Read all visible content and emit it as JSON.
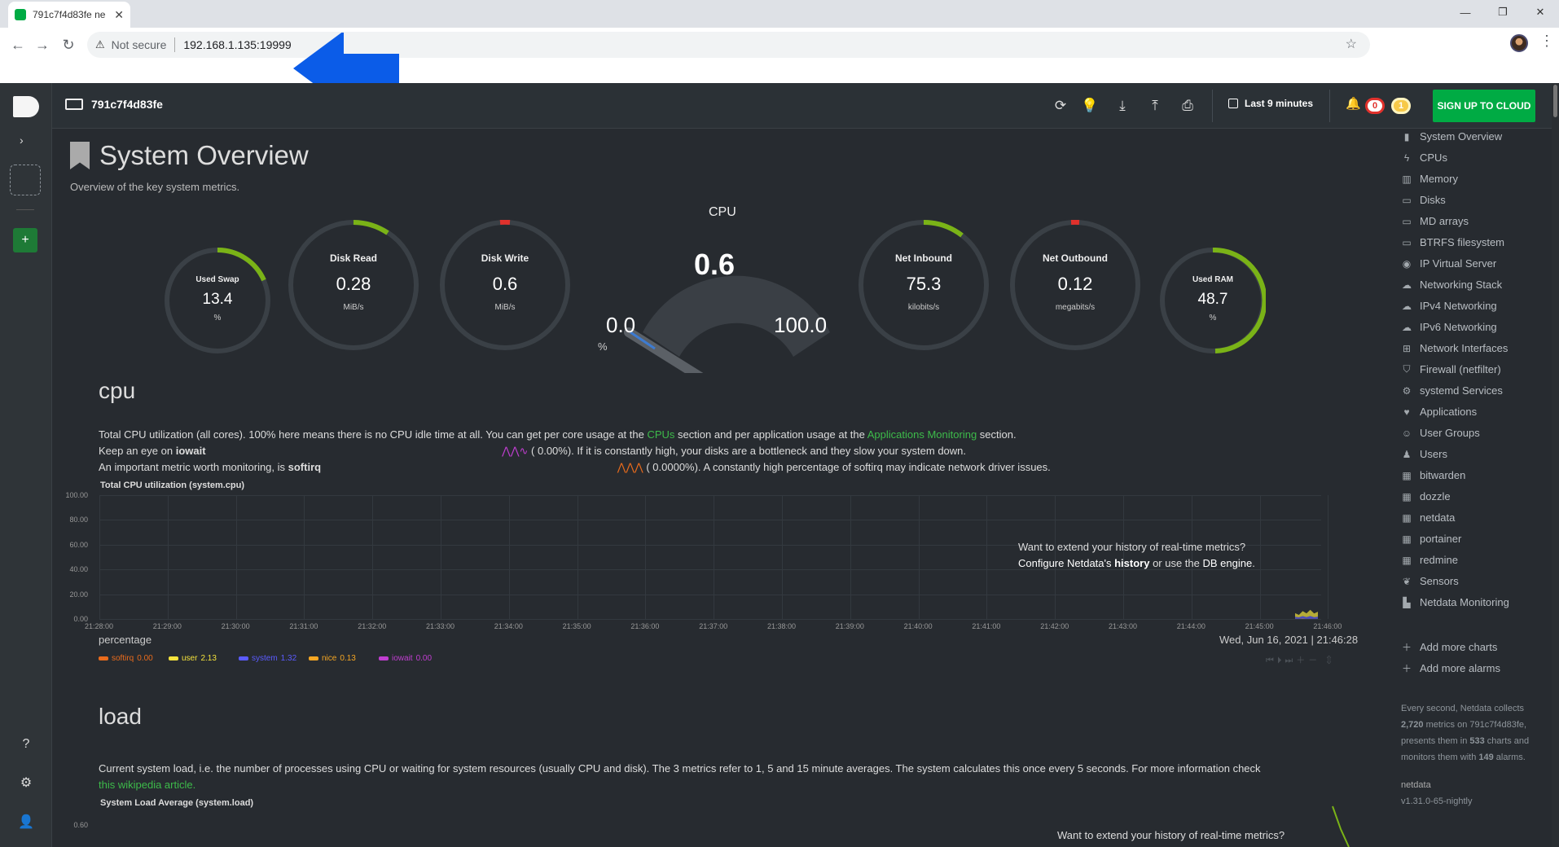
{
  "browser": {
    "tab_title": "791c7f4d83fe ne",
    "security_label": "Not secure",
    "url": "192.168.1.135:19999",
    "window_controls": [
      "minimize",
      "restore",
      "close"
    ]
  },
  "topbar": {
    "hostname": "791c7f4d83fe",
    "time_range": "Last 9 minutes",
    "alarms_critical": "0",
    "alarms_warning": "1",
    "signup_label": "SIGN UP TO CLOUD"
  },
  "overview": {
    "title": "System Overview",
    "subtitle": "Overview of the key system metrics."
  },
  "gauges": [
    {
      "label": "Used Swap",
      "value": "13.4",
      "unit": "%"
    },
    {
      "label": "Disk Read",
      "value": "0.28",
      "unit": "MiB/s"
    },
    {
      "label": "Disk Write",
      "value": "0.6",
      "unit": "MiB/s"
    },
    {
      "label": "Net Inbound",
      "value": "75.3",
      "unit": "kilobits/s"
    },
    {
      "label": "Net Outbound",
      "value": "0.12",
      "unit": "megabits/s"
    },
    {
      "label": "Used RAM",
      "value": "48.7",
      "unit": "%"
    }
  ],
  "cpu_gauge": {
    "label": "CPU",
    "value": "0.6",
    "min": "0.0",
    "max": "100.0",
    "unit": "%"
  },
  "cpu_section": {
    "title": "cpu",
    "desc1_a": "Total CPU utilization (all cores). 100% here means there is no CPU idle time at all. You can get per core usage at the ",
    "desc1_link1": "CPUs",
    "desc1_b": " section and per application usage at the ",
    "desc1_link2": "Applications Monitoring",
    "desc1_c": " section.",
    "desc2_a": "Keep an eye on ",
    "desc2_bold": "iowait",
    "desc2_pct": "(      0.00%). If it is constantly high, your disks are a bottleneck and they slow your system down.",
    "desc3_a": "An important metric worth monitoring, is ",
    "desc3_bold": "softirq",
    "desc3_pct": "(  0.0000%). A constantly high percentage of softirq may indicate network driver issues.",
    "chart_title": "Total CPU utilization (system.cpu)",
    "history_1": "Want to extend your history of real-time metrics?",
    "history_2a": "Configure Netdata's ",
    "history_2b": "history",
    "history_2c": " or use the ",
    "history_2d": "DB engine",
    "history_2e": ".",
    "units": "percentage",
    "timestamp": "Wed, Jun 16, 2021 | 21:46:28"
  },
  "chart_data": {
    "type": "area",
    "title": "Total CPU utilization (system.cpu)",
    "ylabel": "percentage",
    "ylim": [
      0,
      100
    ],
    "yticks": [
      "100.00",
      "80.00",
      "60.00",
      "40.00",
      "20.00",
      "0.00"
    ],
    "x": [
      "21:28:00",
      "21:29:00",
      "21:30:00",
      "21:31:00",
      "21:32:00",
      "21:33:00",
      "21:34:00",
      "21:35:00",
      "21:36:00",
      "21:37:00",
      "21:38:00",
      "21:39:00",
      "21:40:00",
      "21:41:00",
      "21:42:00",
      "21:43:00",
      "21:44:00",
      "21:45:00",
      "21:46:00"
    ],
    "series": [
      {
        "name": "softirq",
        "value": "0.00",
        "color": "#e96b1c"
      },
      {
        "name": "user",
        "value": "2.13",
        "color": "#f4e23c"
      },
      {
        "name": "system",
        "value": "1.32",
        "color": "#5b5bff"
      },
      {
        "name": "nice",
        "value": "0.13",
        "color": "#f5a623"
      },
      {
        "name": "iowait",
        "value": "0.00",
        "color": "#c03ed0"
      }
    ]
  },
  "load_section": {
    "title": "load",
    "desc_a": "Current system load, i.e. the number of processes using CPU or waiting for system resources (usually CPU and disk). The 3 metrics refer to 1, 5 and 15 minute averages. The system calculates this once every 5 seconds. For more information check",
    "desc_link": "this wikipedia article",
    "desc_end": ".",
    "chart_title": "System Load Average (system.load)",
    "ytick": "0.60",
    "history_1": "Want to extend your history of real-time metrics?"
  },
  "rightnav": {
    "items": [
      {
        "label": "System Overview",
        "icon": "bookmark-icon"
      },
      {
        "label": "CPUs",
        "icon": "bolt-icon"
      },
      {
        "label": "Memory",
        "icon": "memory-icon"
      },
      {
        "label": "Disks",
        "icon": "hdd-icon"
      },
      {
        "label": "MD arrays",
        "icon": "hdd-icon"
      },
      {
        "label": "BTRFS filesystem",
        "icon": "hdd-icon"
      },
      {
        "label": "IP Virtual Server",
        "icon": "eye-icon"
      },
      {
        "label": "Networking Stack",
        "icon": "cloud-icon"
      },
      {
        "label": "IPv4 Networking",
        "icon": "cloud-icon"
      },
      {
        "label": "IPv6 Networking",
        "icon": "cloud-icon"
      },
      {
        "label": "Network Interfaces",
        "icon": "sitemap-icon"
      },
      {
        "label": "Firewall (netfilter)",
        "icon": "shield-icon"
      },
      {
        "label": "systemd Services",
        "icon": "cogs-icon"
      },
      {
        "label": "Applications",
        "icon": "heart-icon"
      },
      {
        "label": "User Groups",
        "icon": "users-icon"
      },
      {
        "label": "Users",
        "icon": "user-icon"
      },
      {
        "label": "bitwarden",
        "icon": "grid-icon"
      },
      {
        "label": "dozzle",
        "icon": "grid-icon"
      },
      {
        "label": "netdata",
        "icon": "grid-icon"
      },
      {
        "label": "portainer",
        "icon": "grid-icon"
      },
      {
        "label": "redmine",
        "icon": "grid-icon"
      },
      {
        "label": "Sensors",
        "icon": "leaf-icon"
      },
      {
        "label": "Netdata Monitoring",
        "icon": "chart-icon"
      }
    ],
    "add_charts": "Add more charts",
    "add_alarms": "Add more alarms",
    "footer_a": "Every second, Netdata collects ",
    "footer_metrics": "2,720",
    "footer_b": " metrics on 791c7f4d83fe, presents them in ",
    "footer_charts": "533",
    "footer_c": " charts and monitors them with ",
    "footer_alarms": "149",
    "footer_d": " alarms.",
    "version_name": "netdata",
    "version": "v1.31.0-65-nightly"
  }
}
